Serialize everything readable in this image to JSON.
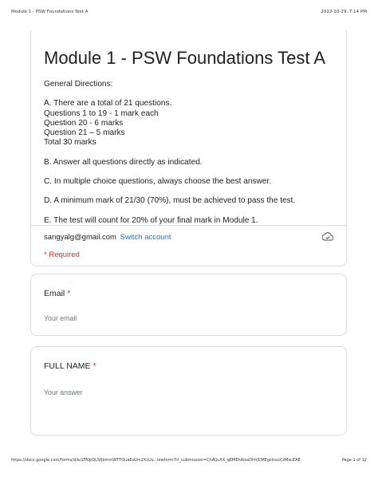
{
  "print_header": {
    "left": "Module 1 - PSW Foundations Test A",
    "right": "2022-10-29, 7:14 PM"
  },
  "form": {
    "title": "Module 1 - PSW Foundations Test A",
    "directions": [
      "General Directions:",
      "",
      "A. There are a total of 21 questions.",
      "Questions 1 to 19 - 1 mark each",
      "Question 20 - 6 marks",
      "Question 21 – 5 marks",
      "Total 30 marks",
      "",
      "B. Answer all questions directly as indicated.",
      "",
      "C. In multiple choice questions, always choose the best answer.",
      "",
      "D. A minimum mark of 21/30 (70%), must be achieved to pass the test.",
      "",
      "E. The test will count for 20% of your final mark in Module 1."
    ],
    "account_email": "sangyalg@gmail.com",
    "switch_account_label": "Switch account",
    "required_note": "* Required",
    "cloud_icon": "cloud-done-icon"
  },
  "questions": [
    {
      "title": "Email",
      "required_mark": "*",
      "placeholder": "Your email"
    },
    {
      "title": "FULL NAME",
      "required_mark": "*",
      "placeholder": "Your answer"
    }
  ],
  "print_footer": {
    "url": "https://docs.google.com/forms/d/e/1FAIpQLSfJbmmWTTQua6sUm2XcUv...iewform?hl_submission=ChAIjuXX_qEMEhAIsaDhhJCMEgzlnucCzMsLEAE",
    "page": "Page 1 of 12"
  },
  "colors": {
    "accent_link": "#1a73e8",
    "required_red": "#d93025",
    "border": "#dadce0"
  }
}
